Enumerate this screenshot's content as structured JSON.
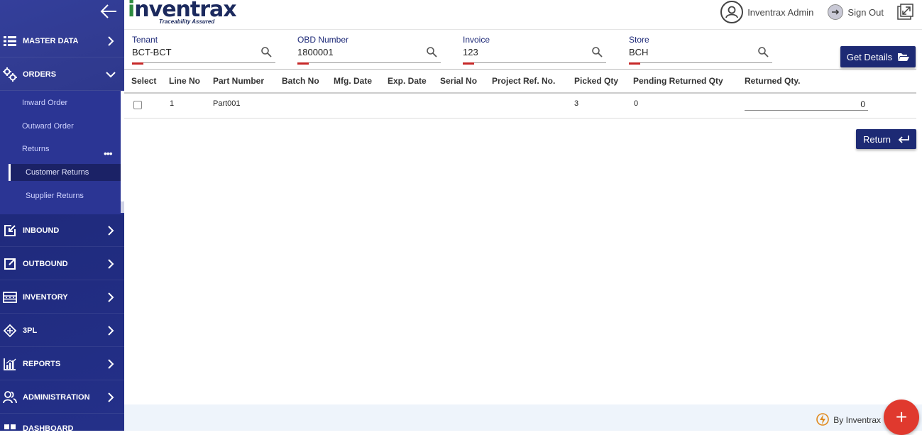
{
  "sidebar": {
    "items": [
      {
        "label": "MASTER DATA",
        "icon": "list-icon"
      },
      {
        "label": "ORDERS",
        "icon": "gears-icon"
      },
      {
        "label": "INBOUND",
        "icon": "inbound-icon"
      },
      {
        "label": "OUTBOUND",
        "icon": "outbound-icon"
      },
      {
        "label": "INVENTORY",
        "icon": "inventory-icon"
      },
      {
        "label": "3PL",
        "icon": "3pl-icon"
      },
      {
        "label": "REPORTS",
        "icon": "reports-icon"
      },
      {
        "label": "ADMINISTRATION",
        "icon": "users-icon"
      },
      {
        "label": "DASHBOARD",
        "icon": "dashboard-icon"
      }
    ],
    "orders_sub": {
      "inward": "Inward Order",
      "outward": "Outward Order",
      "returns": "Returns",
      "customer_returns": "Customer Returns",
      "supplier_returns": "Supplier Returns"
    }
  },
  "header": {
    "logo_main_first": "i",
    "logo_main_rest": "nventrax",
    "logo_tagline": "Traceability Assured",
    "user_name": "Inventrax Admin",
    "sign_out": "Sign Out"
  },
  "filters": {
    "tenant": {
      "label": "Tenant",
      "value": "BCT-BCT"
    },
    "obd": {
      "label": "OBD Number",
      "value": "1800001"
    },
    "invoice": {
      "label": "Invoice",
      "value": "123"
    },
    "store": {
      "label": "Store",
      "value": "BCH"
    }
  },
  "buttons": {
    "get_details": "Get Details",
    "return": "Return"
  },
  "table": {
    "headers": [
      "Select",
      "Line No",
      "Part Number",
      "Batch No",
      "Mfg. Date",
      "Exp. Date",
      "Serial No",
      "Project Ref. No.",
      "Picked Qty",
      "Pending Returned Qty",
      "Returned Qty."
    ],
    "row": {
      "line_no": "1",
      "part_number": "Part001",
      "batch_no": "",
      "mfg_date": "",
      "exp_date": "",
      "serial_no": "",
      "project_ref": "",
      "picked_qty": "3",
      "pending_returned_qty": "0",
      "returned_qty": "0"
    }
  },
  "footer": {
    "by_label": "By Inventrax"
  },
  "colors": {
    "sidebar": "#2a3596",
    "primary_button": "#1d2a74",
    "accent_red": "#c62828",
    "fab": "#e0392e"
  }
}
